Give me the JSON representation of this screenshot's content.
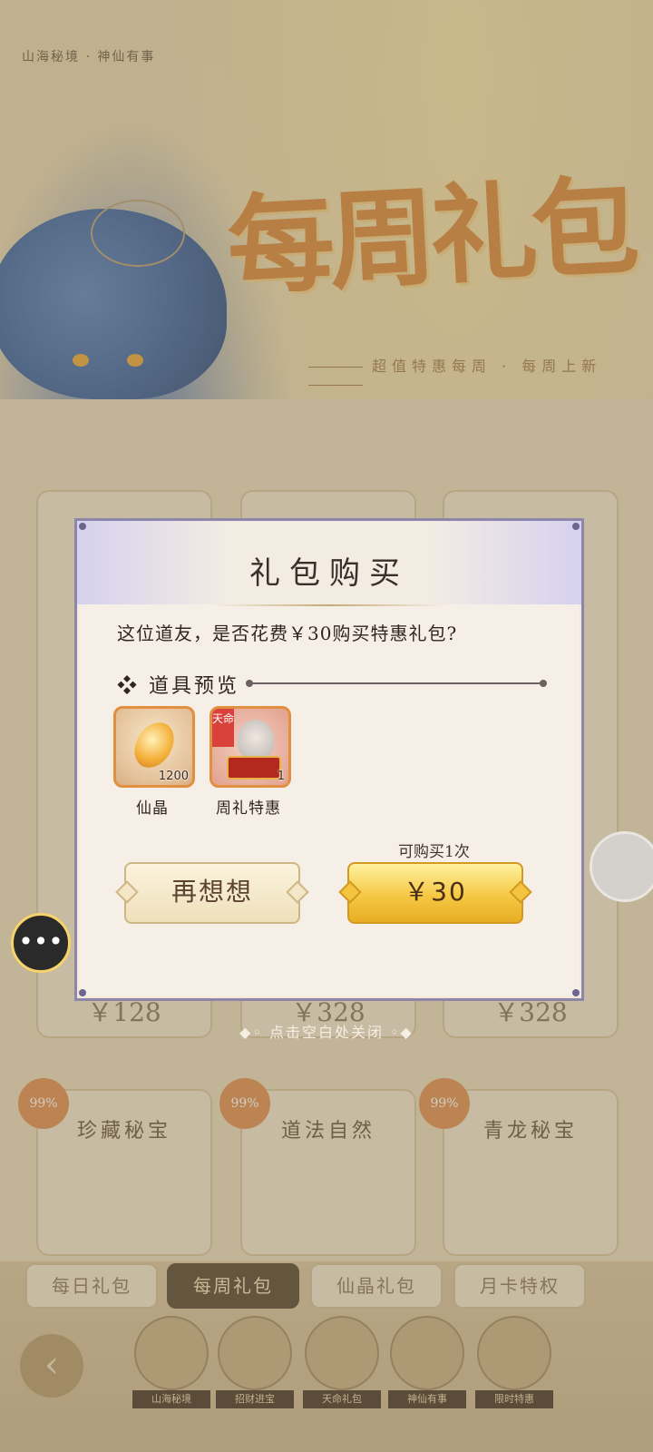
{
  "background": {
    "breadcrumb": "山海秘境 · 神仙有事",
    "banner_title": "每周礼包",
    "banner_subtitle": "超值特惠每周 · 每周上新",
    "cards_row1": [
      {
        "price": "￥128"
      },
      {
        "price": "￥328"
      },
      {
        "price": "￥328"
      }
    ],
    "cards_row2": [
      {
        "title": "珍藏秘宝",
        "badge": "99%"
      },
      {
        "title": "道法自然",
        "badge": "99%"
      },
      {
        "title": "青龙秘宝",
        "badge": "99%"
      }
    ],
    "tabs": [
      "每日礼包",
      "每周礼包",
      "仙晶礼包",
      "月卡特权"
    ],
    "active_tab": "每周礼包",
    "bottom_icons": [
      "山海秘境",
      "招财进宝",
      "天命礼包",
      "神仙有事",
      "限时特惠"
    ],
    "back_icon": "chevron-left-icon",
    "chat_icon": "chat-bubble-icon"
  },
  "modal": {
    "title": "礼包购买",
    "question": "这位道友，是否花费￥30购买特惠礼包?",
    "section_icon": "❖",
    "section_label": "道具预览",
    "items": [
      {
        "name": "仙晶",
        "quantity": "1200",
        "icon": "crystal-icon"
      },
      {
        "name": "周礼特惠",
        "quantity": "1",
        "tag": "天命",
        "icon": "gift-chest-icon"
      }
    ],
    "purchase_limit": "可购买1次",
    "cancel_label": "再想想",
    "confirm_label": "￥30"
  },
  "close_hint": "◆◦ 点击空白处关闭 ◦◆",
  "colors": {
    "accent_gold": "#f5c843",
    "modal_border": "#8e86a8",
    "item_border": "#e19042"
  }
}
